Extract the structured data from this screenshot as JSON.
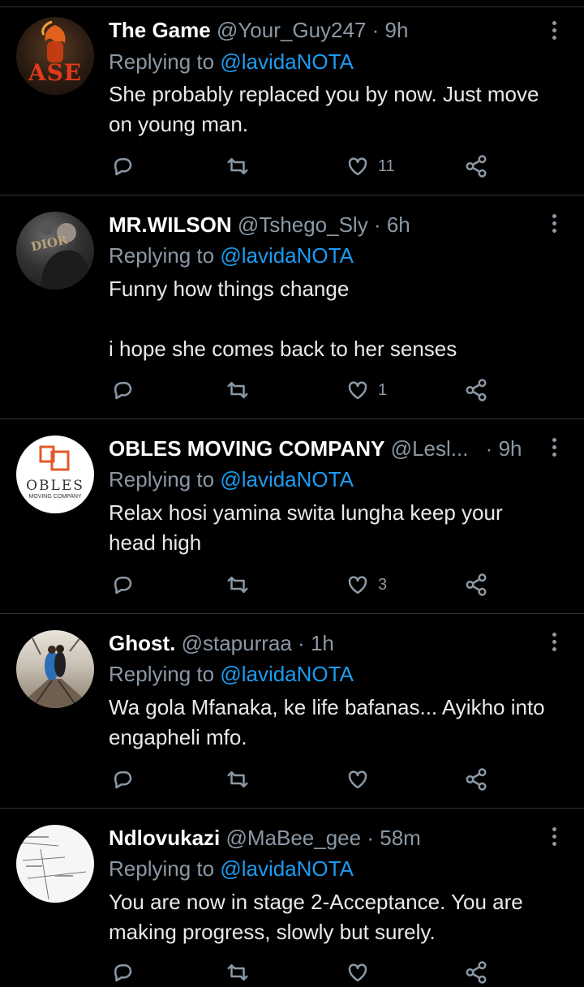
{
  "replying_label": "Replying to",
  "dot": "·",
  "tweets": [
    {
      "name": "The Game",
      "handle": "@Your_Guy247",
      "time": "9h",
      "mention": "@lavidaNOTA",
      "text": "She probably replaced you by now. Just move on young man.",
      "likes": "11",
      "avatar_text": "ASE"
    },
    {
      "name": "MR.WILSON",
      "handle": "@Tshego_Sly",
      "time": "6h",
      "mention": "@lavidaNOTA",
      "text": "Funny how things change\n\ni hope she comes back to her senses",
      "likes": "1",
      "avatar_text": "DIOR"
    },
    {
      "name": "OBLES MOVING COMPANY",
      "handle": "@Lesl...",
      "time": "9h",
      "mention": "@lavidaNOTA",
      "text": "Relax hosi yamina swita lungha keep your head high",
      "likes": "3",
      "avatar_text": "OBLES",
      "avatar_subtext": "MOVING COMPANY"
    },
    {
      "name": "Ghost.",
      "handle": "@stapurraa",
      "time": "1h",
      "mention": "@lavidaNOTA",
      "text": "Wa gola Mfanaka, ke life bafanas... Ayikho into engapheli mfo.",
      "likes": ""
    },
    {
      "name": "Ndlovukazi",
      "handle": "@MaBee_gee",
      "time": "58m",
      "mention": "@lavidaNOTA",
      "text": "You are now in stage 2-Acceptance. You are making progress, slowly but surely.",
      "likes": ""
    }
  ],
  "colors": {
    "background": "#000000",
    "text": "#e7e9ea",
    "muted": "#8b98a5",
    "link": "#1d9bf0",
    "divider": "#2f3336"
  },
  "icons": [
    "more-icon",
    "reply-icon",
    "retweet-icon",
    "like-icon",
    "share-icon"
  ]
}
